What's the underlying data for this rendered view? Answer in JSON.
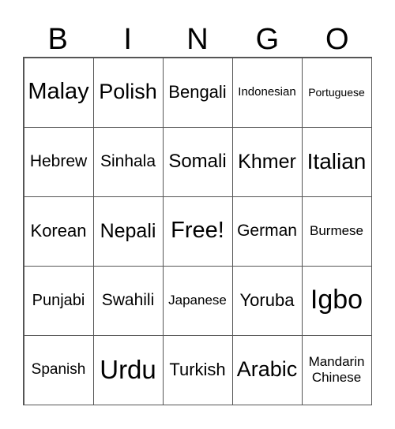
{
  "header": [
    "B",
    "I",
    "N",
    "G",
    "O"
  ],
  "cells": [
    {
      "text": "Malay",
      "size": 29
    },
    {
      "text": "Polish",
      "size": 27
    },
    {
      "text": "Bengali",
      "size": 22
    },
    {
      "text": "Indonesian",
      "size": 15
    },
    {
      "text": "Portuguese",
      "size": 14
    },
    {
      "text": "Hebrew",
      "size": 21
    },
    {
      "text": "Sinhala",
      "size": 21
    },
    {
      "text": "Somali",
      "size": 24
    },
    {
      "text": "Khmer",
      "size": 25
    },
    {
      "text": "Italian",
      "size": 28
    },
    {
      "text": "Korean",
      "size": 22
    },
    {
      "text": "Nepali",
      "size": 25
    },
    {
      "text": "Free!",
      "size": 29
    },
    {
      "text": "German",
      "size": 21
    },
    {
      "text": "Burmese",
      "size": 17
    },
    {
      "text": "Punjabi",
      "size": 20
    },
    {
      "text": "Swahili",
      "size": 21
    },
    {
      "text": "Japanese",
      "size": 17
    },
    {
      "text": "Yoruba",
      "size": 22
    },
    {
      "text": "Igbo",
      "size": 34
    },
    {
      "text": "Spanish",
      "size": 19
    },
    {
      "text": "Urdu",
      "size": 33
    },
    {
      "text": "Turkish",
      "size": 22
    },
    {
      "text": "Arabic",
      "size": 27
    },
    {
      "text": "Mandarin Chinese",
      "size": 17
    }
  ]
}
